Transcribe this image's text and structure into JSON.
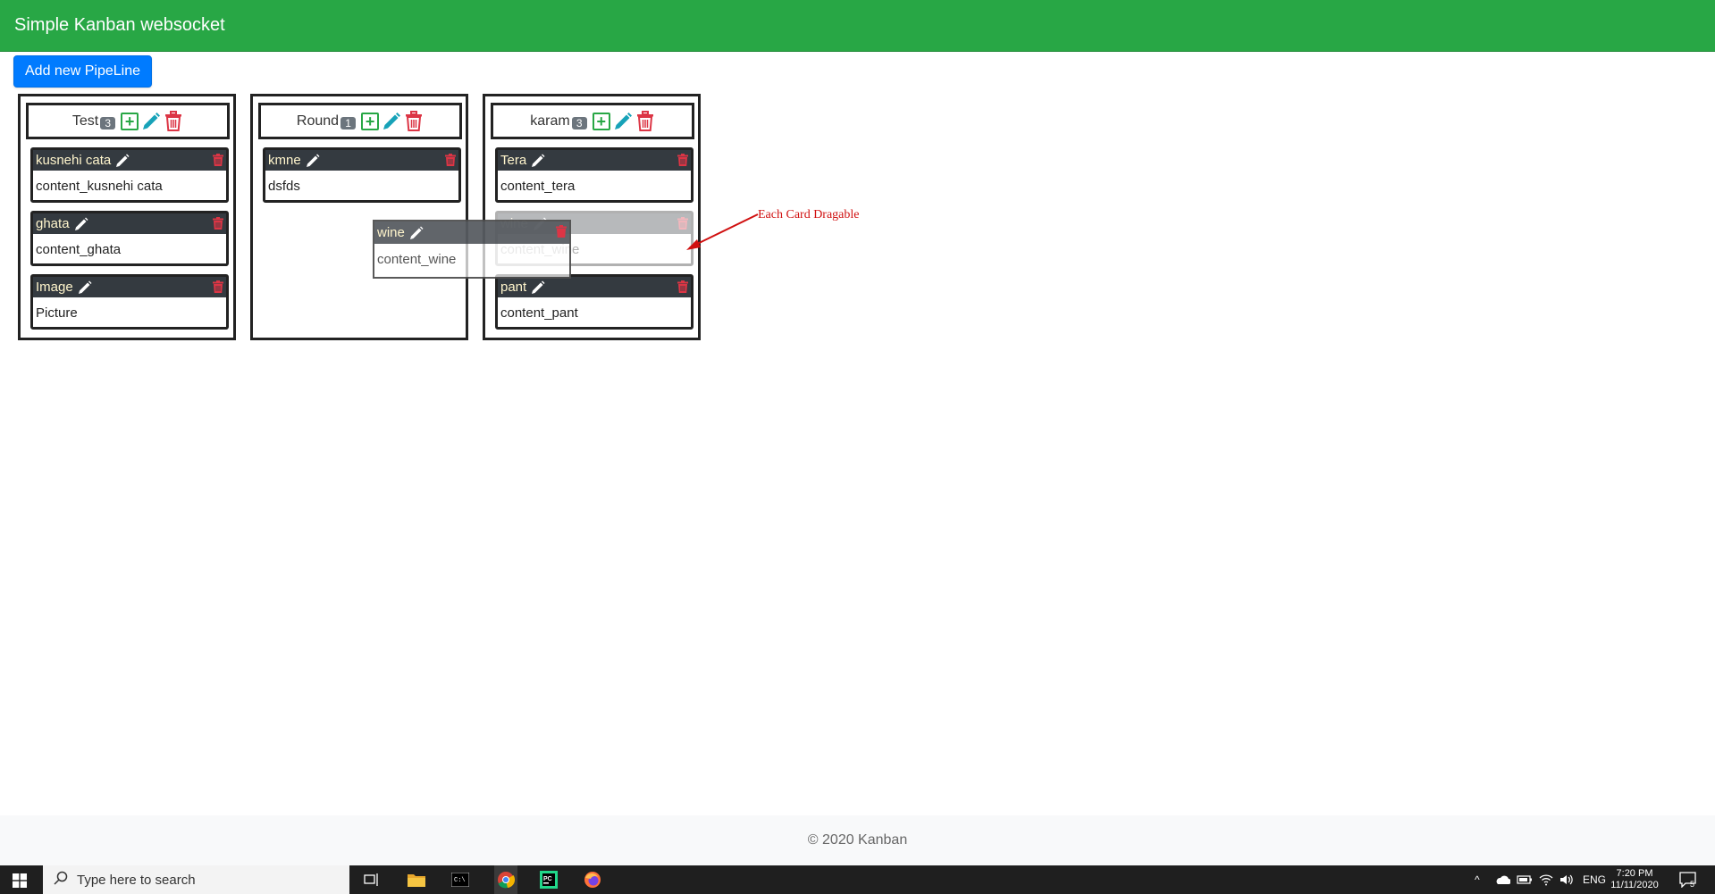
{
  "app": {
    "title": "Simple Kanban websocket"
  },
  "toolbar": {
    "add_pipeline_label": "Add new PipeLine"
  },
  "pipelines": [
    {
      "title": "Test",
      "count": "3",
      "cards": [
        {
          "title": "kusnehi cata",
          "content": "content_kusnehi cata"
        },
        {
          "title": "ghata",
          "content": "content_ghata"
        },
        {
          "title": "Image",
          "content": "Picture"
        }
      ]
    },
    {
      "title": "Round",
      "count": "1",
      "cards": [
        {
          "title": "kmne",
          "content": "dsfds"
        }
      ]
    },
    {
      "title": "karam",
      "count": "3",
      "cards": [
        {
          "title": "Tera",
          "content": "content_tera"
        },
        {
          "title": "wine",
          "content": "content_wine"
        },
        {
          "title": "pant",
          "content": "content_pant"
        }
      ]
    }
  ],
  "drag_ghost": {
    "title": "wine",
    "content": "content_wine"
  },
  "annotation": {
    "text": "Each Card Dragable",
    "color": "#d01010"
  },
  "footer": {
    "text": "© 2020 Kanban"
  },
  "taskbar": {
    "search_placeholder": "Type here to search",
    "language": "ENG",
    "time": "7:20 PM",
    "date": "11/11/2020",
    "notification_count": "5"
  },
  "colors": {
    "header": "#28a745",
    "primary": "#007bff",
    "card_header": "#343a40",
    "edit_icon": "#17a2b8",
    "delete_icon": "#dc3545",
    "badge": "#6c757d"
  }
}
